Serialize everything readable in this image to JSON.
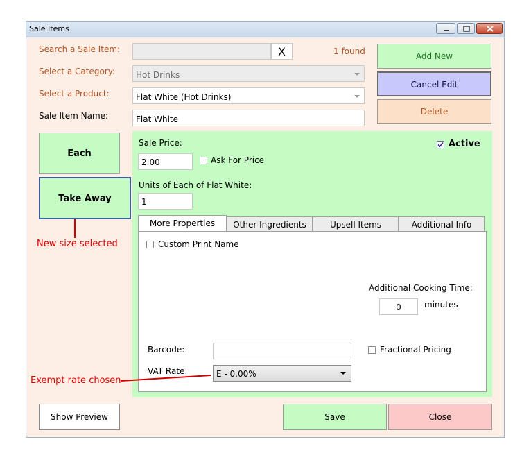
{
  "window": {
    "title": "Sale Items"
  },
  "search": {
    "label": "Search a Sale Item:",
    "value": "",
    "clear_glyph": "X",
    "found_text": "1 found"
  },
  "category": {
    "label": "Select a Category:",
    "value": "Hot Drinks"
  },
  "product": {
    "label": "Select a Product:",
    "value": "Flat White (Hot Drinks)"
  },
  "sale_item_name": {
    "label": "Sale Item Name:",
    "value": "Flat White"
  },
  "actions": {
    "add_new": "Add New",
    "cancel_edit": "Cancel Edit",
    "delete": "Delete"
  },
  "sizes": {
    "each": "Each",
    "take_away": "Take Away"
  },
  "price": {
    "label": "Sale Price:",
    "value": "2.00",
    "ask_for_price": "Ask For Price",
    "ask_checked": false
  },
  "active": {
    "label": "Active",
    "checked": true
  },
  "units": {
    "label": "Units of Each of Flat White:",
    "value": "1"
  },
  "tabs": [
    "More Properties",
    "Other Ingredients",
    "Upsell Items",
    "Additional Info"
  ],
  "more_properties": {
    "custom_print_name": "Custom Print Name",
    "cooking_time_label": "Additional Cooking Time:",
    "cooking_time_value": "0",
    "cooking_time_unit": "minutes",
    "barcode_label": "Barcode:",
    "barcode_value": "",
    "fractional_pricing": "Fractional Pricing",
    "vat_label": "VAT Rate:",
    "vat_value": "E - 0.00%"
  },
  "footer": {
    "show_preview": "Show Preview",
    "save": "Save",
    "close": "Close"
  },
  "annotations": {
    "size_note": "New size selected",
    "vat_note": "Exempt rate chosen"
  },
  "colors": {
    "green": "#c4fcc4",
    "blue": "#c8c8fc",
    "orange": "#fce0c8",
    "pink": "#fcc8c8",
    "annotation": "#e00000"
  }
}
